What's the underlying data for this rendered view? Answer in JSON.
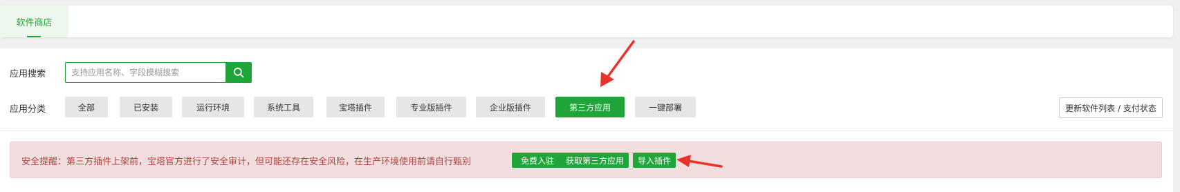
{
  "top_tabs": [
    {
      "label": "软件商店"
    }
  ],
  "search": {
    "label": "应用搜索",
    "placeholder": "支持应用名称、字段模糊搜索"
  },
  "category": {
    "label": "应用分类",
    "items": [
      {
        "label": "全部"
      },
      {
        "label": "已安装"
      },
      {
        "label": "运行环境"
      },
      {
        "label": "系统工具"
      },
      {
        "label": "宝塔插件"
      },
      {
        "label": "专业版插件"
      },
      {
        "label": "企业版插件"
      },
      {
        "label": "第三方应用",
        "active": true
      },
      {
        "label": "一键部署"
      }
    ]
  },
  "update_button": {
    "label": "更新软件列表 / 支付状态"
  },
  "alert": {
    "text": "安全提醒：第三方插件上架前，宝塔官方进行了安全审计，但可能还存在安全风险，在生产环境使用前请自行甄别",
    "buttons": [
      {
        "label": "免费入驻"
      },
      {
        "label": "获取第三方应用"
      },
      {
        "label": "导入插件"
      }
    ]
  },
  "colors": {
    "accent": "#20a53a",
    "alert_bg": "#f2dede",
    "alert_text": "#a94442",
    "arrow": "#e8332a"
  }
}
